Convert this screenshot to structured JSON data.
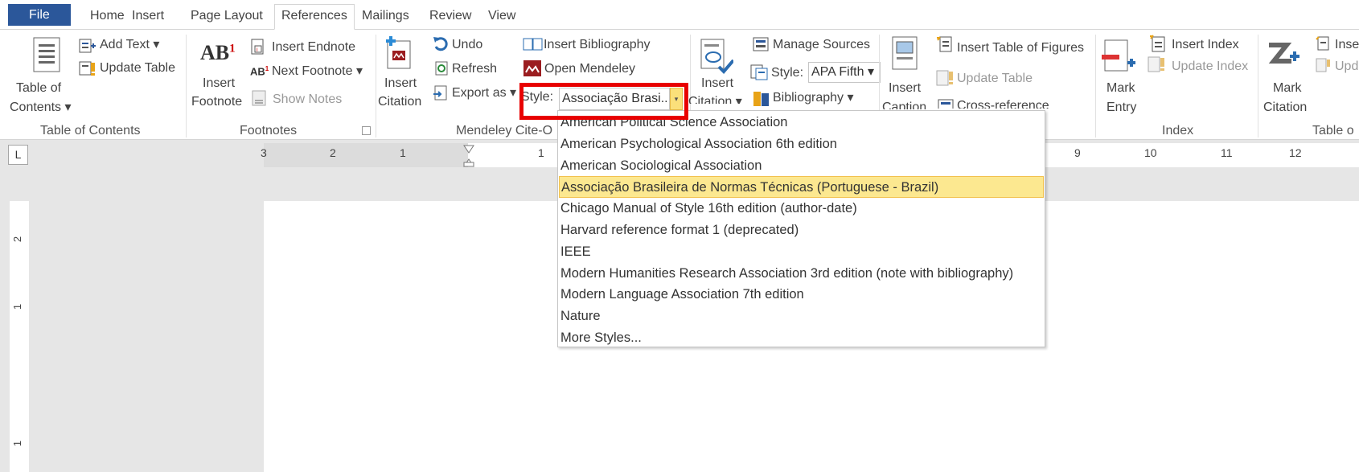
{
  "tabs": [
    "File",
    "Home",
    "Insert",
    "Page Layout",
    "References",
    "Mailings",
    "Review",
    "View"
  ],
  "toc": {
    "table_of_contents": "Table of",
    "table_of_contents2": "Contents",
    "add_text": "Add Text",
    "update_table": "Update Table",
    "group": "Table of Contents"
  },
  "footnotes": {
    "insert_footnote1": "Insert",
    "insert_footnote2": "Footnote",
    "insert_endnote": "Insert Endnote",
    "next_footnote": "Next Footnote",
    "show_notes": "Show Notes",
    "group": "Footnotes"
  },
  "mendeley": {
    "insert_citation1": "Insert",
    "insert_citation2": "Citation",
    "undo": "Undo",
    "refresh": "Refresh",
    "export_as": "Export as",
    "insert_bibliography": "Insert Bibliography",
    "open_mendeley": "Open Mendeley",
    "style_label": "Style:",
    "style_value": "Associação Brasi...",
    "group": "Mendeley Cite-O"
  },
  "citations": {
    "insert_citation1": "Insert",
    "insert_citation2": "Citation",
    "manage_sources": "Manage Sources",
    "style_label": "Style:",
    "style_value": "APA Fifth",
    "bibliography": "Bibliography"
  },
  "captions": {
    "insert_caption1": "Insert",
    "insert_caption2": "Caption",
    "insert_table_of_figures": "Insert Table of Figures",
    "update_table": "Update Table",
    "cross_reference": "Cross-reference"
  },
  "index": {
    "mark_entry1": "Mark",
    "mark_entry2": "Entry",
    "insert_index": "Insert Index",
    "update_index": "Update Index",
    "group": "Index"
  },
  "authorities": {
    "mark_citation1": "Mark",
    "mark_citation2": "Citation",
    "insert": "Inse",
    "update": "Upd",
    "group": "Table o"
  },
  "ruler": {
    "left_numbers": [
      "3",
      "2",
      "1",
      "1"
    ],
    "right_numbers": [
      "9",
      "10",
      "11",
      "12"
    ]
  },
  "vruler": [
    "2",
    "1",
    "1"
  ],
  "style_menu": {
    "items": [
      "American Political Science Association",
      "American Psychological Association 6th edition",
      "American Sociological Association",
      "Associação Brasileira de Normas Técnicas (Portuguese - Brazil)",
      "Chicago Manual of Style 16th edition (author-date)",
      "Harvard reference format 1 (deprecated)",
      "IEEE",
      "Modern Humanities Research Association 3rd edition (note with bibliography)",
      "Modern Language Association 7th edition",
      "Nature",
      "More Styles..."
    ],
    "selected": "Associação Brasileira de Normas Técnicas (Portuguese - Brazil)",
    "highlight_color": "#fce890"
  },
  "colors": {
    "file_tab": "#2b579a",
    "highlight_box": "#e80000"
  }
}
